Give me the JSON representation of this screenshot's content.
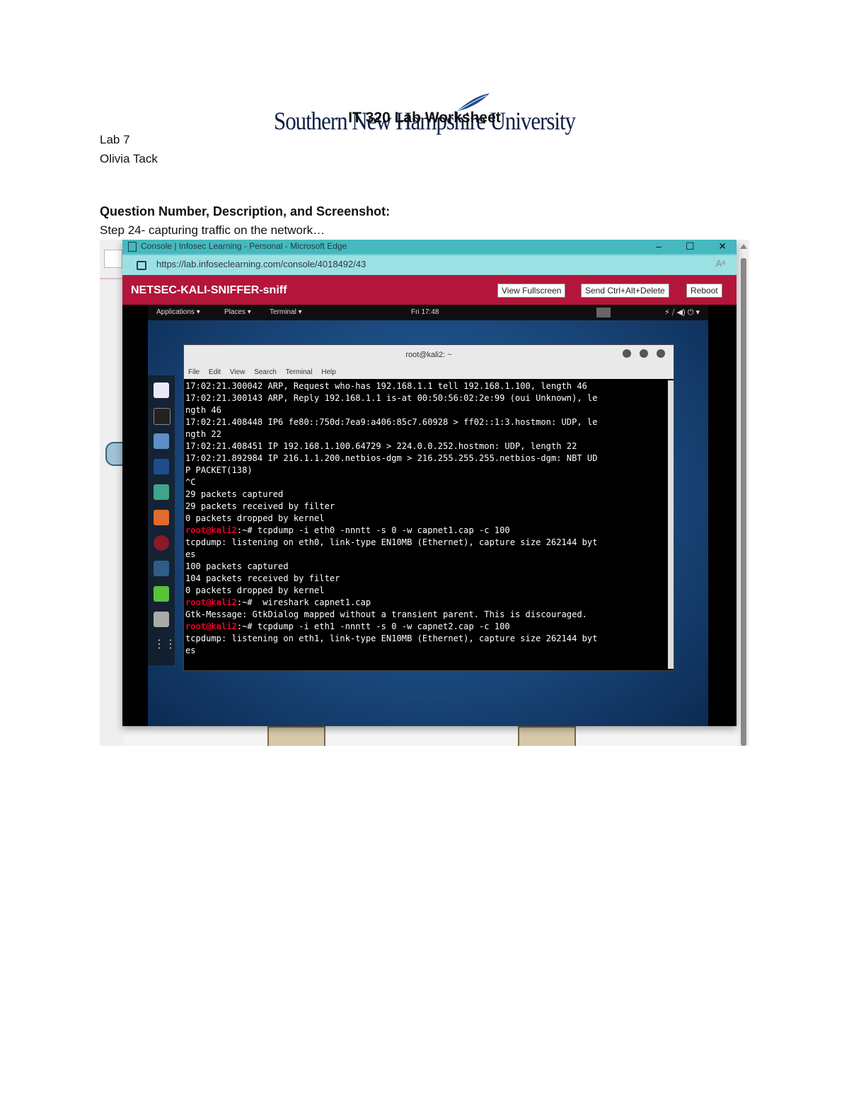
{
  "logo": {
    "text": "Southern New Hampshire University"
  },
  "document": {
    "title": "IT 320 Lab Worksheet",
    "lab": "Lab 7",
    "author": "Olivia Tack",
    "heading": "Question Number, Description, and Screenshot:",
    "step": "Step 24- capturing traffic on the network…"
  },
  "browser": {
    "tab_title": "Console | Infosec Learning - Personal - Microsoft Edge",
    "url": "https://lab.infoseclearning.com/console/4018492/43",
    "reader_icon": "Aᵃ",
    "controls": [
      "–",
      "☐",
      "✕"
    ]
  },
  "lab": {
    "name": "NETSEC-KALI-SNIFFER-sniff",
    "buttons": [
      "View Fullscreen",
      "Send Ctrl+Alt+Delete",
      "Reboot"
    ]
  },
  "kali": {
    "applications": "Applications ▾",
    "places": "Places ▾",
    "terminal_menu": "Terminal ▾",
    "clock": "Fri 17:48",
    "tray": "⚡  ⧸  ◀)  ⏻ ▾"
  },
  "terminal": {
    "title": "root@kali2: ~",
    "menu": [
      "File",
      "Edit",
      "View",
      "Search",
      "Terminal",
      "Help"
    ],
    "prompt": "root@kali2",
    "lines": [
      {
        "p": "",
        "t": "17:02:21.300042 ARP, Request who-has 192.168.1.1 tell 192.168.1.100, length 46"
      },
      {
        "p": "",
        "t": "17:02:21.300143 ARP, Reply 192.168.1.1 is-at 00:50:56:02:2e:99 (oui Unknown), le"
      },
      {
        "p": "",
        "t": "ngth 46"
      },
      {
        "p": "",
        "t": "17:02:21.408448 IP6 fe80::750d:7ea9:a406:85c7.60928 > ff02::1:3.hostmon: UDP, le"
      },
      {
        "p": "",
        "t": "ngth 22"
      },
      {
        "p": "",
        "t": "17:02:21.408451 IP 192.168.1.100.64729 > 224.0.0.252.hostmon: UDP, length 22"
      },
      {
        "p": "",
        "t": "17:02:21.892984 IP 216.1.1.200.netbios-dgm > 216.255.255.255.netbios-dgm: NBT UD"
      },
      {
        "p": "",
        "t": "P PACKET(138)"
      },
      {
        "p": "",
        "t": "^C"
      },
      {
        "p": "",
        "t": "29 packets captured"
      },
      {
        "p": "",
        "t": "29 packets received by filter"
      },
      {
        "p": "",
        "t": "0 packets dropped by kernel"
      },
      {
        "p": "root@kali2",
        "t": ":~# tcpdump -i eth0 -nnntt -s 0 -w capnet1.cap -c 100"
      },
      {
        "p": "",
        "t": "tcpdump: listening on eth0, link-type EN10MB (Ethernet), capture size 262144 byt"
      },
      {
        "p": "",
        "t": "es"
      },
      {
        "p": "",
        "t": "100 packets captured"
      },
      {
        "p": "",
        "t": "104 packets received by filter"
      },
      {
        "p": "",
        "t": "0 packets dropped by kernel"
      },
      {
        "p": "root@kali2",
        "t": ":~#  wireshark capnet1.cap"
      },
      {
        "p": "",
        "t": "Gtk-Message: GtkDialog mapped without a transient parent. This is discouraged."
      },
      {
        "p": "root@kali2",
        "t": ":~# tcpdump -i eth1 -nnntt -s 0 -w capnet2.cap -c 100"
      },
      {
        "p": "",
        "t": "tcpdump: listening on eth1, link-type EN10MB (Ethernet), capture size 262144 byt"
      },
      {
        "p": "",
        "t": "es"
      }
    ]
  },
  "colors": {
    "lab_header": "#b3163a",
    "edge_teal": "#45b9bf",
    "prompt_red": "#e7002a"
  },
  "dock_icons": [
    "browser-icon",
    "terminal-icon",
    "files-icon",
    "metasploit-icon",
    "armitage-icon",
    "burpsuite-icon",
    "maltego-icon",
    "wireshark-icon",
    "leafpad-icon",
    "app-icon",
    "show-apps-icon"
  ]
}
